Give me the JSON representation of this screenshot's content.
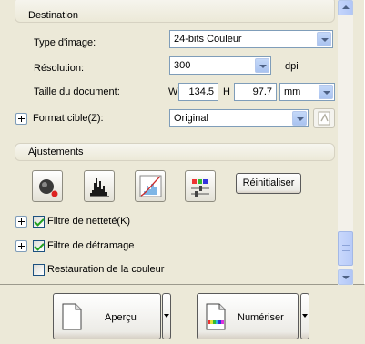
{
  "destination": {
    "header": "Destination",
    "image_type": {
      "label": "Type d'image:",
      "value": "24-bits Couleur"
    },
    "resolution": {
      "label": "Résolution:",
      "value": "300",
      "unit": "dpi"
    },
    "document_size": {
      "label": "Taille du document:",
      "w_label": "W",
      "w_value": "134.5",
      "h_label": "H",
      "h_value": "97.7",
      "unit": "mm"
    },
    "target_format": {
      "label": "Format cible(Z):",
      "value": "Original"
    }
  },
  "adjustments": {
    "header": "Ajustements",
    "tools": [
      "auto-exposure-icon",
      "histogram-icon",
      "tone-curve-icon",
      "color-palette-icon"
    ],
    "reset_label": "Réinitialiser",
    "unsharp": {
      "label": "Filtre de netteté(K)",
      "checked": true
    },
    "descreening": {
      "label": "Filtre de détramage",
      "checked": true
    },
    "color_restoration": {
      "label": "Restauration de la couleur",
      "checked": false
    }
  },
  "actions": {
    "preview_label": "Aperçu",
    "scan_label": "Numériser"
  }
}
